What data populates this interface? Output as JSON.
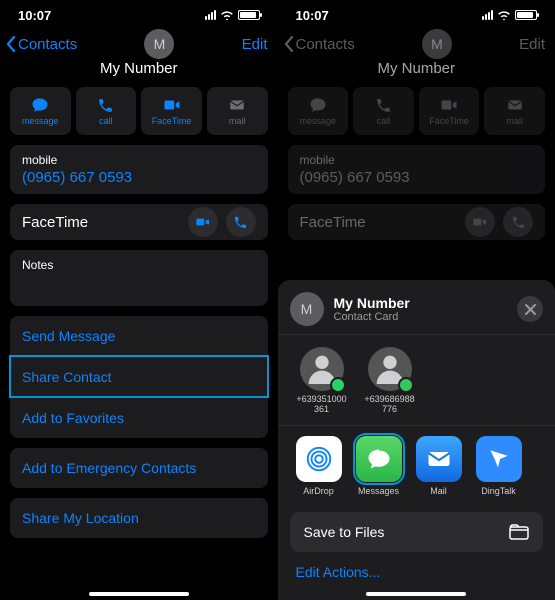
{
  "status": {
    "time": "10:07"
  },
  "nav": {
    "back": "Contacts",
    "edit": "Edit"
  },
  "avatar_initial": "M",
  "contact_title": "My Number",
  "actions": {
    "message": "message",
    "call": "call",
    "facetime": "FaceTime",
    "mail": "mail"
  },
  "mobile": {
    "label": "mobile",
    "value": "(0965) 667 0593"
  },
  "facetime_label": "FaceTime",
  "notes_label": "Notes",
  "links": {
    "send_message": "Send Message",
    "share_contact": "Share Contact",
    "add_favorites": "Add to Favorites",
    "add_emergency": "Add to Emergency Contacts",
    "share_location": "Share My Location"
  },
  "sheet": {
    "title": "My Number",
    "subtitle": "Contact Card",
    "contacts": [
      {
        "number": "+639351000361"
      },
      {
        "number": "+639686988776"
      }
    ],
    "apps": {
      "airdrop": "AirDrop",
      "messages": "Messages",
      "mail": "Mail",
      "dingtalk": "DingTalk"
    },
    "save_to_files": "Save to Files",
    "edit_actions": "Edit Actions..."
  }
}
